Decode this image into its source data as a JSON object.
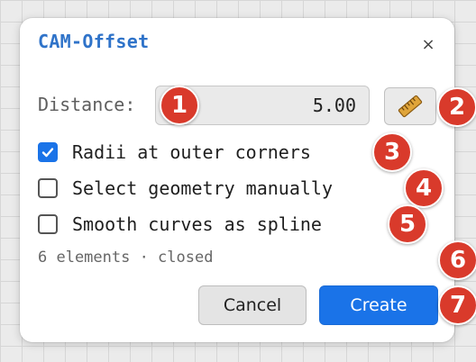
{
  "dialog": {
    "title": "CAM-Offset",
    "close_label": "×"
  },
  "distance": {
    "label": "Distance:",
    "value": "5.00",
    "tool_icon": "ruler-icon"
  },
  "options": [
    {
      "label": "Radii at outer corners",
      "checked": true
    },
    {
      "label": "Select geometry manually",
      "checked": false
    },
    {
      "label": "Smooth curves as spline",
      "checked": false
    }
  ],
  "status": "6 elements · closed",
  "buttons": {
    "cancel": "Cancel",
    "create": "Create"
  },
  "markers": [
    "1",
    "2",
    "3",
    "4",
    "5",
    "6",
    "7"
  ],
  "colors": {
    "accent": "#1a73e8",
    "title": "#2f73c9",
    "marker": "#d93a2b"
  }
}
